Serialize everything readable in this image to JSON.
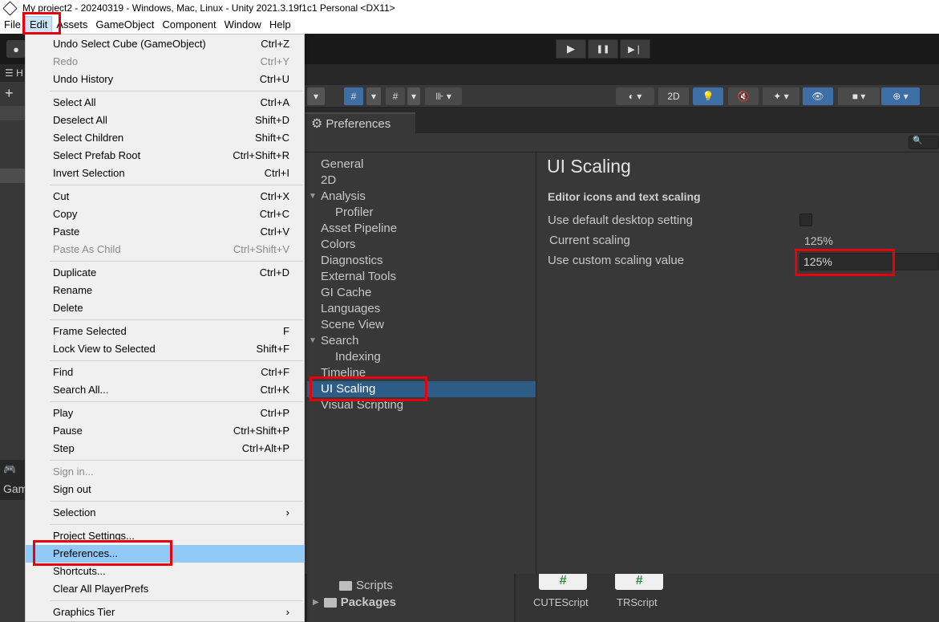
{
  "window": {
    "title": "My project2 - 20240319 - Windows, Mac, Linux - Unity 2021.3.19f1c1 Personal <DX11>"
  },
  "menubar": {
    "items": [
      "File",
      "Edit",
      "Assets",
      "GameObject",
      "Component",
      "Window",
      "Help"
    ],
    "active": "Edit"
  },
  "play_controls": {
    "play": "▶",
    "pause": "❚❚",
    "step": "▶❘"
  },
  "left_panel": {
    "hierarchy_label": "H",
    "add": "+",
    "game_label": "Gam",
    "game_icon": "C"
  },
  "scene_toolbar": {
    "two_d_label": "2D"
  },
  "edit_menu": {
    "groups": [
      [
        {
          "label": "Undo Select Cube (GameObject)",
          "shortcut": "Ctrl+Z",
          "enabled": true
        },
        {
          "label": "Redo",
          "shortcut": "Ctrl+Y",
          "enabled": false
        },
        {
          "label": "Undo History",
          "shortcut": "Ctrl+U",
          "enabled": true
        }
      ],
      [
        {
          "label": "Select All",
          "shortcut": "Ctrl+A",
          "enabled": true
        },
        {
          "label": "Deselect All",
          "shortcut": "Shift+D",
          "enabled": true
        },
        {
          "label": "Select Children",
          "shortcut": "Shift+C",
          "enabled": true
        },
        {
          "label": "Select Prefab Root",
          "shortcut": "Ctrl+Shift+R",
          "enabled": true
        },
        {
          "label": "Invert Selection",
          "shortcut": "Ctrl+I",
          "enabled": true
        }
      ],
      [
        {
          "label": "Cut",
          "shortcut": "Ctrl+X",
          "enabled": true
        },
        {
          "label": "Copy",
          "shortcut": "Ctrl+C",
          "enabled": true
        },
        {
          "label": "Paste",
          "shortcut": "Ctrl+V",
          "enabled": true
        },
        {
          "label": "Paste As Child",
          "shortcut": "Ctrl+Shift+V",
          "enabled": false
        }
      ],
      [
        {
          "label": "Duplicate",
          "shortcut": "Ctrl+D",
          "enabled": true
        },
        {
          "label": "Rename",
          "shortcut": "",
          "enabled": true
        },
        {
          "label": "Delete",
          "shortcut": "",
          "enabled": true
        }
      ],
      [
        {
          "label": "Frame Selected",
          "shortcut": "F",
          "enabled": true
        },
        {
          "label": "Lock View to Selected",
          "shortcut": "Shift+F",
          "enabled": true
        }
      ],
      [
        {
          "label": "Find",
          "shortcut": "Ctrl+F",
          "enabled": true
        },
        {
          "label": "Search All...",
          "shortcut": "Ctrl+K",
          "enabled": true
        }
      ],
      [
        {
          "label": "Play",
          "shortcut": "Ctrl+P",
          "enabled": true
        },
        {
          "label": "Pause",
          "shortcut": "Ctrl+Shift+P",
          "enabled": true
        },
        {
          "label": "Step",
          "shortcut": "Ctrl+Alt+P",
          "enabled": true
        }
      ],
      [
        {
          "label": "Sign in...",
          "shortcut": "",
          "enabled": false
        },
        {
          "label": "Sign out",
          "shortcut": "",
          "enabled": true
        }
      ],
      [
        {
          "label": "Selection",
          "shortcut": "›",
          "enabled": true
        }
      ],
      [
        {
          "label": "Project Settings...",
          "shortcut": "",
          "enabled": true
        },
        {
          "label": "Preferences...",
          "shortcut": "",
          "enabled": true,
          "highlighted": true
        },
        {
          "label": "Shortcuts...",
          "shortcut": "",
          "enabled": true
        },
        {
          "label": "Clear All PlayerPrefs",
          "shortcut": "",
          "enabled": true
        }
      ],
      [
        {
          "label": "Graphics Tier",
          "shortcut": "›",
          "enabled": true
        }
      ]
    ]
  },
  "preferences": {
    "tab_label": "Preferences",
    "search_glyph": "🔍",
    "categories": [
      {
        "label": "General",
        "level": 0
      },
      {
        "label": "2D",
        "level": 0
      },
      {
        "label": "Analysis",
        "level": 0,
        "expanded": true
      },
      {
        "label": "Profiler",
        "level": 1
      },
      {
        "label": "Asset Pipeline",
        "level": 0
      },
      {
        "label": "Colors",
        "level": 0
      },
      {
        "label": "Diagnostics",
        "level": 0
      },
      {
        "label": "External Tools",
        "level": 0
      },
      {
        "label": "GI Cache",
        "level": 0
      },
      {
        "label": "Languages",
        "level": 0
      },
      {
        "label": "Scene View",
        "level": 0
      },
      {
        "label": "Search",
        "level": 0,
        "expanded": true
      },
      {
        "label": "Indexing",
        "level": 1
      },
      {
        "label": "Timeline",
        "level": 0
      },
      {
        "label": "UI Scaling",
        "level": 0,
        "selected": true
      },
      {
        "label": "Visual Scripting",
        "level": 0
      }
    ],
    "page_title": "UI Scaling",
    "section_title": "Editor icons and text scaling",
    "settings": {
      "use_default_label": "Use default desktop setting",
      "use_default_checked": false,
      "current_label": "Current scaling",
      "current_value": "125%",
      "custom_label": "Use custom scaling value",
      "custom_value": "125%"
    }
  },
  "project": {
    "tree": [
      {
        "label": "Scripts"
      },
      {
        "label": "Packages"
      }
    ],
    "assets": [
      {
        "name": "CUTEScript",
        "glyph": "#"
      },
      {
        "name": "TRScript",
        "glyph": "#"
      }
    ]
  },
  "colors": {
    "highlight_box": "#e8000b",
    "selection": "#2c5d87",
    "menu_hover": "#91c9f7"
  }
}
